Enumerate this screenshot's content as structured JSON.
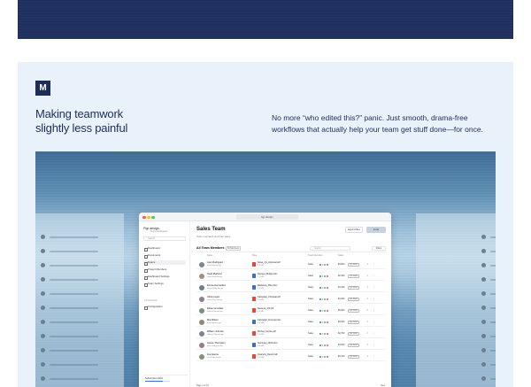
{
  "section": {
    "logo_letter": "M",
    "headline_lines": [
      "Making teamwork",
      "slightly less painful"
    ],
    "description_lines": [
      "No more “who edited this?” panic. Just smooth, drama-free",
      "workflows that actually help your team get stuff done—for once."
    ]
  },
  "app": {
    "url": "figr.design",
    "brand": "Figr design",
    "brand_sub": "Team workspace",
    "search_placeholder": "Search",
    "nav": [
      "Dashboard",
      "Documents",
      "Teams",
      "Project Members",
      "Dashboard Settings",
      "Team Settings"
    ],
    "nav_active_index": 2,
    "section_label": "ADVANCED",
    "config_item": "Configuration",
    "page_title": "Sales Team",
    "page_subtitle": "Team members and their sales",
    "export_label": "Export Files",
    "invite_label": "Invite",
    "table_title": "All Team Members",
    "table_count": "84 Members",
    "table_search": "Search",
    "filter_label": "Filters",
    "columns": [
      "Name",
      "Files",
      "Team Members",
      "Sales"
    ],
    "rows": [
      {
        "name": "Liam Rodriguez",
        "email": "liam@figr.design",
        "file": "Notes_Q1_Approval.pdf",
        "size": "2.4 MB",
        "team": "Sales",
        "amount": "$3,800",
        "badge": "Q1 2024",
        "ficon": "#e8453c"
      },
      {
        "name": "Noah Martinez",
        "email": "noah@figr.design",
        "file": "Revised_Budget.xlsx",
        "size": "1.1 MB",
        "team": "Sales",
        "amount": "$2,400",
        "badge": "Q1 2024",
        "ficon": "#3b6fd8"
      },
      {
        "name": "Emma Hernandez",
        "email": "emma@figr.design",
        "file": "Marketing_Plan.docx",
        "size": "3.2 MB",
        "team": "Sales",
        "amount": "$4,100",
        "badge": "Q2 2024",
        "ficon": "#3b6fd8"
      },
      {
        "name": "Olivia Lopez",
        "email": "olivia@figr.design",
        "file": "Campaign_Proposal.pdf",
        "size": "2.0 MB",
        "team": "Sales",
        "amount": "$1,900",
        "badge": "Q2 2024",
        "ficon": "#e8453c"
      },
      {
        "name": "Ethan Gonzalez",
        "email": "ethan@figr.design",
        "file": "Revenue_Q3.pdf",
        "size": "1.8 MB",
        "team": "Sales",
        "amount": "$5,200",
        "badge": "Q3 2024",
        "ficon": "#e8453c"
      },
      {
        "name": "Mia Wilson",
        "email": "mia@figr.design",
        "file": "Campaign_Forecast.xlsx",
        "size": "2.6 MB",
        "team": "Sales",
        "amount": "$3,300",
        "badge": "Q3 2024",
        "ficon": "#3b6fd8"
      },
      {
        "name": "William Johnson",
        "email": "william@figr.design",
        "file": "Pitches_Invoice.pdf",
        "size": "1.3 MB",
        "team": "Sales",
        "amount": "$2,700",
        "badge": "Q4 2024",
        "ficon": "#e8453c"
      },
      {
        "name": "James Thompson",
        "email": "james@figr.design",
        "file": "Summary_2024.docx",
        "size": "0.9 MB",
        "team": "Sales",
        "amount": "$4,600",
        "badge": "Q4 2024",
        "ficon": "#3b6fd8"
      },
      {
        "name": "Ava Garcia",
        "email": "ava@figr.design",
        "file": "Quarterly_Report.pdf",
        "size": "2.2 MB",
        "team": "Sales",
        "amount": "$3,100",
        "badge": "Q4 2024",
        "ficon": "#e8453c"
      }
    ],
    "promo_title": "Subscription 100%",
    "promo_progress": 0.7,
    "pager": "Page 1 of 10",
    "next": "Next"
  },
  "colors": {
    "navy": "#1c2e57",
    "accent": "#3b6fd8",
    "card_bg": "#e9f1fb"
  }
}
